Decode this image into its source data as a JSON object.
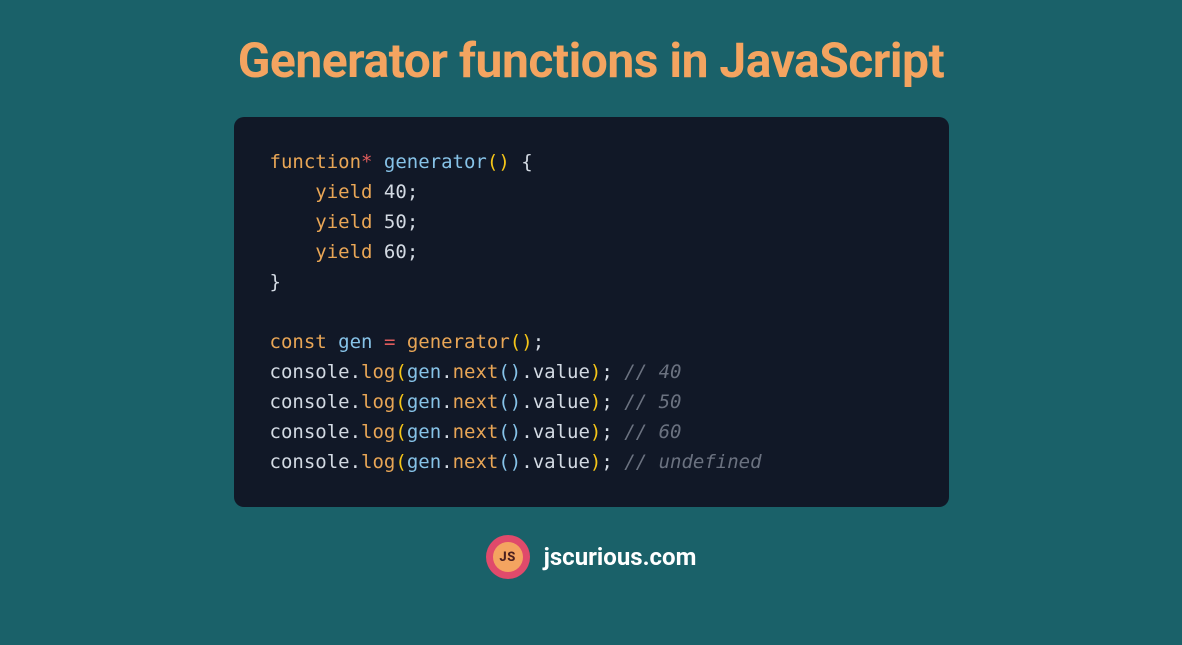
{
  "title": "Generator functions in JavaScript",
  "code": {
    "l1": {
      "a": "function",
      "b": "*",
      "c": " ",
      "d": "generator",
      "e": "()",
      "f": " {"
    },
    "l2": {
      "a": "    ",
      "b": "yield",
      "c": " ",
      "d": "40",
      "e": ";"
    },
    "l3": {
      "a": "    ",
      "b": "yield",
      "c": " ",
      "d": "50",
      "e": ";"
    },
    "l4": {
      "a": "    ",
      "b": "yield",
      "c": " ",
      "d": "60",
      "e": ";"
    },
    "l5": {
      "a": "}"
    },
    "l6": {
      "a": ""
    },
    "l7": {
      "a": "const",
      "b": " ",
      "c": "gen",
      "d": " ",
      "e": "=",
      "f": " ",
      "g": "generator",
      "h": "()",
      "i": ";"
    },
    "l8": {
      "a": "console",
      "b": ".",
      "c": "log",
      "d": "(",
      "e": "gen",
      "f": ".",
      "g": "next",
      "h": "()",
      "i": ".",
      "j": "value",
      "k": ")",
      "l": ";",
      "m": " // 40"
    },
    "l9": {
      "a": "console",
      "b": ".",
      "c": "log",
      "d": "(",
      "e": "gen",
      "f": ".",
      "g": "next",
      "h": "()",
      "i": ".",
      "j": "value",
      "k": ")",
      "l": ";",
      "m": " // 50"
    },
    "l10": {
      "a": "console",
      "b": ".",
      "c": "log",
      "d": "(",
      "e": "gen",
      "f": ".",
      "g": "next",
      "h": "()",
      "i": ".",
      "j": "value",
      "k": ")",
      "l": ";",
      "m": " // 60"
    },
    "l11": {
      "a": "console",
      "b": ".",
      "c": "log",
      "d": "(",
      "e": "gen",
      "f": ".",
      "g": "next",
      "h": "()",
      "i": ".",
      "j": "value",
      "k": ")",
      "l": ";",
      "m": " // undefined"
    }
  },
  "logo": "JS",
  "site": "jscurious.com"
}
